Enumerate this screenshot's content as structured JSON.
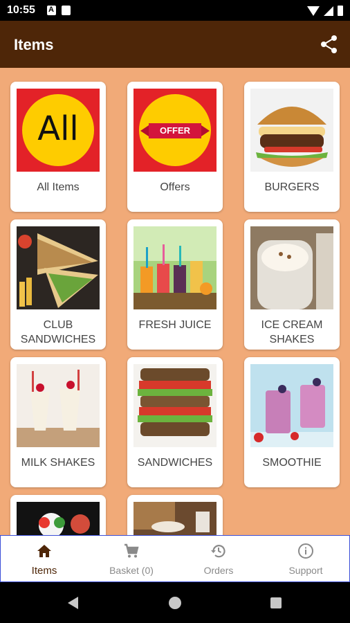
{
  "status_bar": {
    "time": "10:55"
  },
  "app_bar": {
    "title": "Items",
    "share_icon": "share-icon"
  },
  "items": [
    {
      "label": "All Items",
      "image_text": "All"
    },
    {
      "label": "Offers",
      "image_text": "OFFER"
    },
    {
      "label": "BURGERS"
    },
    {
      "label": "CLUB SANDWICHES"
    },
    {
      "label": "FRESH JUICE"
    },
    {
      "label": "ICE CREAM SHAKES"
    },
    {
      "label": "MILK SHAKES"
    },
    {
      "label": "SANDWICHES"
    },
    {
      "label": "SMOOTHIE"
    },
    {
      "label": ""
    },
    {
      "label": ""
    }
  ],
  "bottom_nav": [
    {
      "label": "Items",
      "icon": "home-icon",
      "active": true
    },
    {
      "label": "Basket (0)",
      "icon": "cart-icon",
      "active": false
    },
    {
      "label": "Orders",
      "icon": "history-icon",
      "active": false
    },
    {
      "label": "Support",
      "icon": "info-icon",
      "active": false
    }
  ],
  "colors": {
    "app_bar": "#4e2608",
    "background": "#f1aa78",
    "accent_red": "#e32228",
    "accent_yellow": "#fecc00"
  }
}
